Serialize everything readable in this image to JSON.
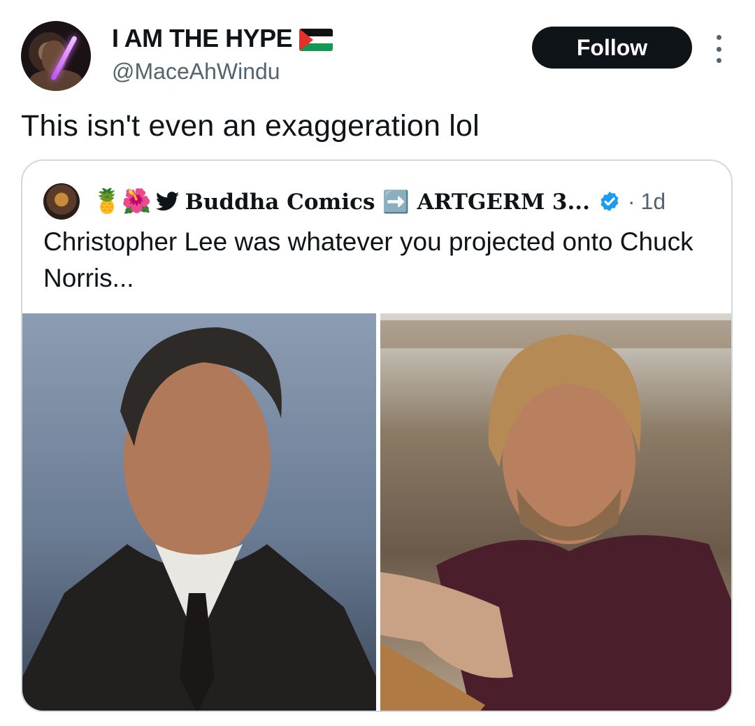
{
  "tweet": {
    "display_name": "I AM THE HYPE",
    "handle": "@MaceAhWindu",
    "follow_label": "Follow",
    "text": "This isn't even an exaggeration lol"
  },
  "quote": {
    "emoji_prefix": "🍍🌺",
    "name": "Buddha Comics ➡️ ARTGERM 3...",
    "time_separator": "·",
    "time": "1d",
    "text": "Christopher Lee was whatever you projected onto Chuck Norris..."
  },
  "icons": {
    "flag": "palestine-flag-icon",
    "more": "more-vertical-icon",
    "verified": "verified-badge-icon",
    "bird": "twitter-bird-icon"
  },
  "colors": {
    "follow_bg": "#0f1419",
    "verified_blue": "#1d9bf0",
    "secondary_text": "#536471",
    "card_border": "#cfd9de"
  }
}
